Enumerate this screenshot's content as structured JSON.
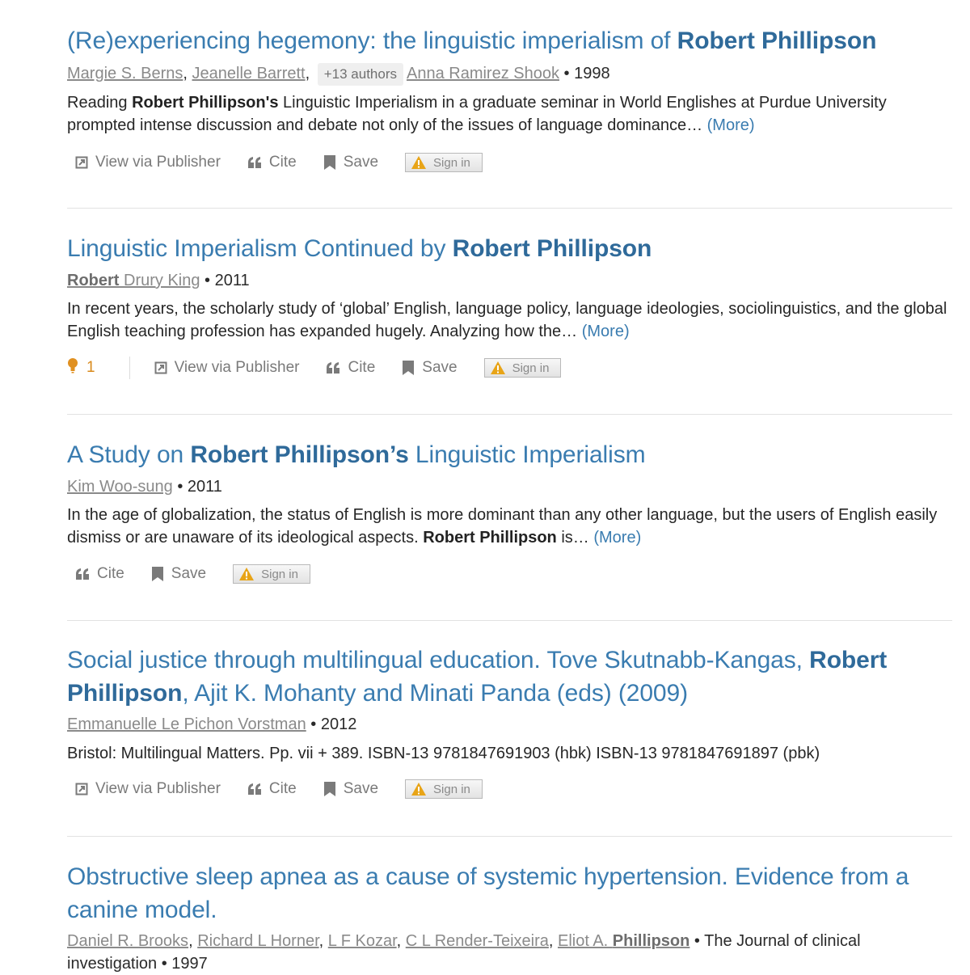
{
  "results": [
    {
      "title_parts": [
        [
          "(Re)experiencing hegemony: the linguistic imperialism of ",
          false
        ],
        [
          "Robert Phillipson",
          true
        ]
      ],
      "authors": [
        {
          "name_parts": [
            [
              "Margie S. Berns",
              false
            ]
          ],
          "sep": ", "
        },
        {
          "name_parts": [
            [
              "Jeanelle Barrett",
              false
            ]
          ],
          "sep": ", "
        },
        {
          "pill": "+13 authors",
          "sep": ""
        },
        {
          "name_parts": [
            [
              "Anna Ramirez Shook",
              false
            ]
          ],
          "sep": ""
        }
      ],
      "meta_tail": " • 1998",
      "abstract_parts": [
        [
          "Reading ",
          false
        ],
        [
          "Robert Phillipson's",
          true
        ],
        [
          " Linguistic Imperialism in a graduate seminar in World Englishes at Purdue University prompted intense discussion and debate not only of the issues of language dominance…",
          false
        ]
      ],
      "more": "(More)",
      "influence": null,
      "actions": [
        "View via Publisher",
        "Cite",
        "Save"
      ],
      "signin": "Sign in"
    },
    {
      "title_parts": [
        [
          "Linguistic Imperialism Continued by ",
          false
        ],
        [
          "Robert Phillipson",
          true
        ]
      ],
      "authors": [
        {
          "name_parts": [
            [
              "Robert",
              true
            ],
            [
              " Drury King",
              false
            ]
          ],
          "sep": ""
        }
      ],
      "meta_tail": " • 2011",
      "abstract_parts": [
        [
          "In recent years, the scholarly study of ‘global’ English, language policy, language ideologies, sociolinguistics, and the global English teaching profession has expanded hugely. Analyzing how the…",
          false
        ]
      ],
      "more": "(More)",
      "influence": "1",
      "actions": [
        "View via Publisher",
        "Cite",
        "Save"
      ],
      "signin": "Sign in"
    },
    {
      "title_parts": [
        [
          "A Study on ",
          false
        ],
        [
          "Robert Phillipson’s",
          true
        ],
        [
          " Linguistic Imperialism",
          false
        ]
      ],
      "authors": [
        {
          "name_parts": [
            [
              "Kim Woo-sung",
              false
            ]
          ],
          "sep": ""
        }
      ],
      "meta_tail": " • 2011",
      "abstract_parts": [
        [
          "In the age of globalization, the status of English is more dominant than any other language, but the users of English easily dismiss or are unaware of its ideological aspects. ",
          false
        ],
        [
          "Robert Phillipson",
          true
        ],
        [
          " is…",
          false
        ]
      ],
      "more": "(More)",
      "influence": null,
      "actions": [
        "Cite",
        "Save"
      ],
      "signin": "Sign in"
    },
    {
      "title_parts": [
        [
          "Social justice through multilingual education. Tove Skutnabb-Kangas, ",
          false
        ],
        [
          "Robert Phillipson",
          true
        ],
        [
          ", Ajit K. Mohanty and Minati Panda (eds) (2009)",
          false
        ]
      ],
      "authors": [
        {
          "name_parts": [
            [
              "Emmanuelle Le Pichon Vorstman",
              false
            ]
          ],
          "sep": ""
        }
      ],
      "meta_tail": " • 2012",
      "abstract_parts": [
        [
          "Bristol: Multilingual Matters. Pp. vii + 389. ISBN-13 9781847691903 (hbk) ISBN-13 9781847691897 (pbk)",
          false
        ]
      ],
      "more": "",
      "influence": null,
      "actions": [
        "View via Publisher",
        "Cite",
        "Save"
      ],
      "signin": "Sign in"
    },
    {
      "title_parts": [
        [
          "Obstructive sleep apnea as a cause of systemic hypertension. Evidence from a canine model.",
          false
        ]
      ],
      "authors": [
        {
          "name_parts": [
            [
              "Daniel R. Brooks",
              false
            ]
          ],
          "sep": ", "
        },
        {
          "name_parts": [
            [
              "Richard L Horner",
              false
            ]
          ],
          "sep": ", "
        },
        {
          "name_parts": [
            [
              "L F Kozar",
              false
            ]
          ],
          "sep": ", "
        },
        {
          "name_parts": [
            [
              "C L Render-Teixeira",
              false
            ]
          ],
          "sep": ", "
        },
        {
          "name_parts": [
            [
              "Eliot A. ",
              false
            ],
            [
              "Phillipson",
              true
            ]
          ],
          "sep": ""
        }
      ],
      "meta_tail": " • The Journal of clinical investigation • 1997",
      "abstract_parts": [],
      "more": "",
      "influence": null,
      "actions": [],
      "signin": ""
    }
  ]
}
